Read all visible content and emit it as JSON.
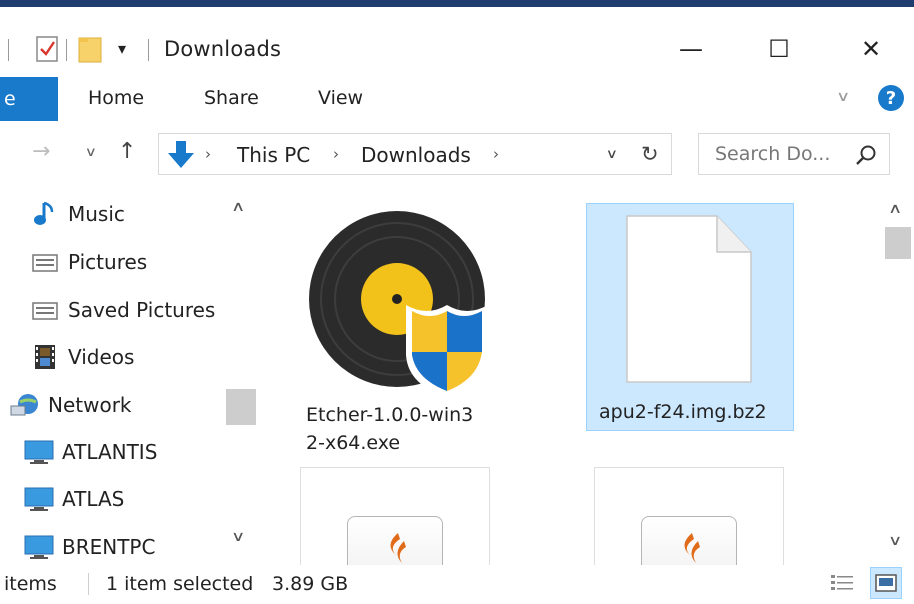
{
  "window": {
    "title": "Downloads",
    "minimize_glyph": "—",
    "maximize_glyph": "☐",
    "close_glyph": "✕"
  },
  "ribbon": {
    "file_tab": "e",
    "tabs": [
      "Home",
      "Share",
      "View"
    ],
    "help_glyph": "?"
  },
  "address": {
    "crumbs": [
      "This PC",
      "Downloads"
    ],
    "search_placeholder": "Search Do...",
    "location_icon": "download-arrow-icon"
  },
  "nav_pane": {
    "items": [
      {
        "label": "Music",
        "icon": "music-note-icon"
      },
      {
        "label": "Pictures",
        "icon": "pictures-folder-icon"
      },
      {
        "label": "Saved Pictures",
        "icon": "pictures-folder-icon"
      },
      {
        "label": "Videos",
        "icon": "film-strip-icon"
      },
      {
        "label": "Network",
        "icon": "network-icon"
      },
      {
        "label": "ATLANTIS",
        "icon": "computer-icon"
      },
      {
        "label": "ATLAS",
        "icon": "computer-icon"
      },
      {
        "label": "BRENTPC",
        "icon": "computer-icon"
      }
    ]
  },
  "files": [
    {
      "name_line1": "Etcher-1.0.0-win3",
      "name_line2": "2-x64.exe",
      "icon": "etcher-disc-shield-icon",
      "selected": false
    },
    {
      "name_line1": "apu2-f24.img.bz2",
      "name_line2": "",
      "icon": "blank-file-icon",
      "selected": true
    }
  ],
  "status": {
    "items": "items",
    "selected": "1 item selected",
    "size": "3.89 GB"
  },
  "colors": {
    "accent": "#1979ca",
    "selection_bg": "#cce8ff",
    "selection_border": "#99d1ff",
    "title_border": "#1f3d6e"
  }
}
